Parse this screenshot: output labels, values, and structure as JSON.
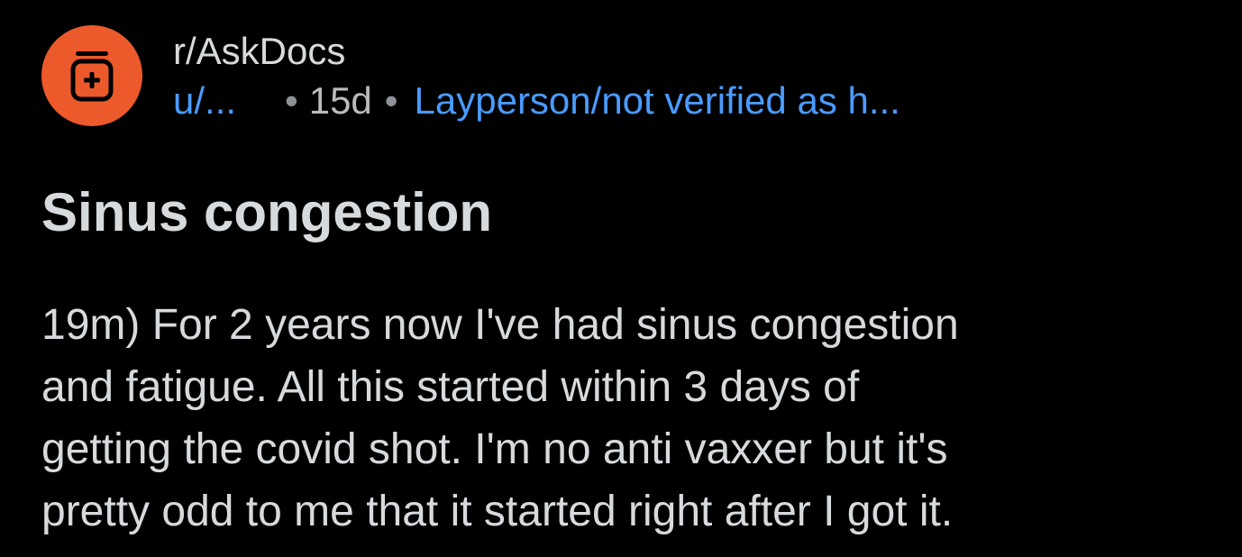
{
  "post": {
    "subreddit": "r/AskDocs",
    "author": "u/...",
    "separator": "•",
    "age": "15d",
    "flair": "Layperson/not verified as h...",
    "title": "Sinus congestion",
    "body_lines": [
      "19m) For 2 years now I've had sinus congestion",
      "and fatigue. All this started within 3 days of",
      "getting the covid shot. I'm no anti vaxxer but it's",
      "pretty odd to me that it started right after I got it."
    ]
  },
  "icons": {
    "avatar": "medicine-jar-icon"
  },
  "colors": {
    "background": "#000000",
    "avatar": "#ec5a2b",
    "link": "#4a9bff",
    "text": "#d7dadc"
  }
}
